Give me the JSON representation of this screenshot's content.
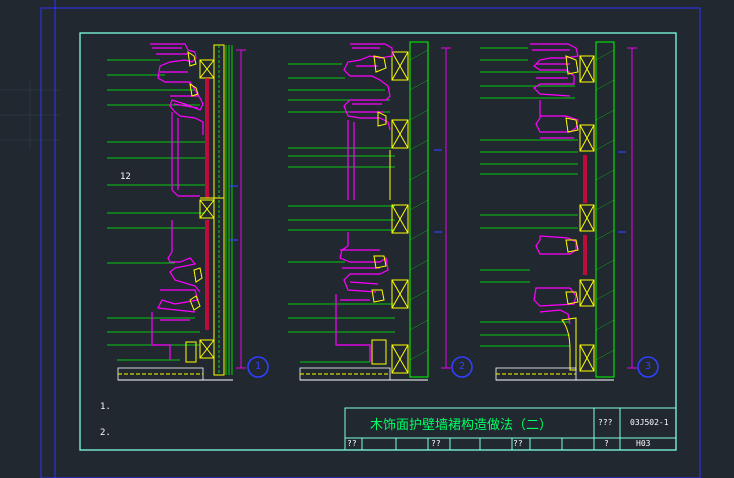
{
  "drawing": {
    "dimension_label": "12",
    "section_markers": [
      "1",
      "2",
      "3"
    ],
    "notes": [
      "1.",
      "2."
    ]
  },
  "title_block": {
    "title": "木饰面护壁墙裙构造做法（二）",
    "field_marks": [
      "???",
      "?",
      "??",
      "??",
      "??"
    ],
    "drawing_number": "03J502-1",
    "page": "H03"
  },
  "colors": {
    "background": "#212830",
    "frame_outer": "#3030ff",
    "frame_inner": "#7fffe0",
    "leader": "#00ff00",
    "molding": "#ff00ff",
    "panel": "#ffff00",
    "marker": "#3040ff"
  }
}
